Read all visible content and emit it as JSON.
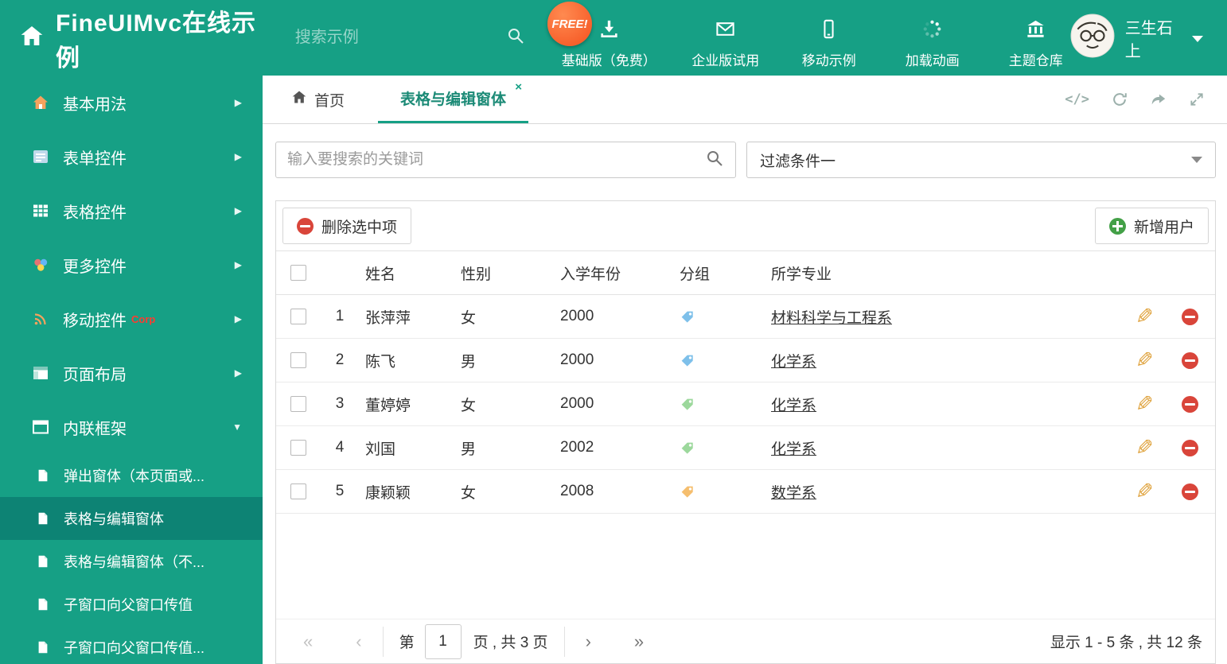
{
  "colors": {
    "primary": "#16A085",
    "sidebar_selected": "#0D8374",
    "free_badge": "#F4511E",
    "delete_red": "#D9453A",
    "add_green": "#43A047",
    "edit_pencil": "#DFA23C",
    "tag_blue": "#7EC0EA",
    "tag_green": "#9CD89C",
    "tag_orange": "#F5BE6E"
  },
  "header": {
    "title": "FineUIMvc在线示例",
    "search_placeholder": "搜索示例",
    "free_badge": "FREE!",
    "nav": [
      {
        "label": "基础版（免费）"
      },
      {
        "label": "企业版试用"
      },
      {
        "label": "移动示例"
      },
      {
        "label": "加载动画"
      },
      {
        "label": "主题仓库"
      }
    ],
    "user_name": "三生石上"
  },
  "sidebar": {
    "items": [
      {
        "label": "基本用法"
      },
      {
        "label": "表单控件"
      },
      {
        "label": "表格控件"
      },
      {
        "label": "更多控件"
      },
      {
        "label": "移动控件",
        "badge": "Corp"
      },
      {
        "label": "页面布局"
      },
      {
        "label": "内联框架"
      }
    ],
    "subitems": [
      {
        "label": "弹出窗体（本页面或..."
      },
      {
        "label": "表格与编辑窗体"
      },
      {
        "label": "表格与编辑窗体（不..."
      },
      {
        "label": "子窗口向父窗口传值"
      },
      {
        "label": "子窗口向父窗口传值..."
      }
    ]
  },
  "tabs": {
    "home": "首页",
    "active": "表格与编辑窗体"
  },
  "filter": {
    "search_placeholder": "输入要搜索的关键词",
    "dropdown_value": "过滤条件一"
  },
  "toolbar": {
    "delete_label": "删除选中项",
    "add_label": "新增用户"
  },
  "table": {
    "columns": {
      "name": "姓名",
      "gender": "性别",
      "year": "入学年份",
      "group": "分组",
      "major": "所学专业"
    },
    "rows": [
      {
        "num": "1",
        "name": "张萍萍",
        "gender": "女",
        "year": "2000",
        "tag_color": "#7EC0EA",
        "major": "材料科学与工程系"
      },
      {
        "num": "2",
        "name": "陈飞",
        "gender": "男",
        "year": "2000",
        "tag_color": "#7EC0EA",
        "major": "化学系"
      },
      {
        "num": "3",
        "name": "董婷婷",
        "gender": "女",
        "year": "2000",
        "tag_color": "#9CD89C",
        "major": "化学系"
      },
      {
        "num": "4",
        "name": "刘国",
        "gender": "男",
        "year": "2002",
        "tag_color": "#9CD89C",
        "major": "化学系"
      },
      {
        "num": "5",
        "name": "康颖颖",
        "gender": "女",
        "year": "2008",
        "tag_color": "#F5BE6E",
        "major": "数学系"
      }
    ]
  },
  "pagination": {
    "label_page": "第",
    "current_page": "1",
    "label_total": "页 , 共 3 页",
    "summary": "显示 1 - 5 条 , 共 12 条"
  }
}
